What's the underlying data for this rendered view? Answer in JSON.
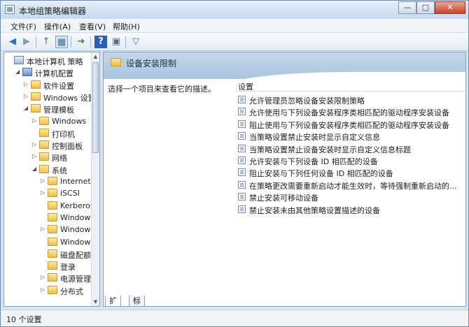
{
  "window": {
    "title": "本地组策略编辑器",
    "controls": {
      "minimize": "—",
      "maximize": "□",
      "close": "✕"
    }
  },
  "menu": [
    {
      "label": "文件(F)"
    },
    {
      "label": "操作(A)"
    },
    {
      "label": "查看(V)"
    },
    {
      "label": "帮助(H)"
    }
  ],
  "toolbar": {
    "back": "◀",
    "forward": "▶",
    "up": "↑",
    "showhide": "▦",
    "export": "➜",
    "help": "?",
    "properties": "▣",
    "filter": "▽",
    "icons": [
      "back-arrow-icon",
      "forward-arrow-icon",
      "up-folder-icon",
      "show-hide-tree-icon",
      "export-list-icon",
      "help-icon",
      "properties-icon",
      "filter-icon"
    ]
  },
  "tree": [
    {
      "label": "本地计算机 策略",
      "indent": 0,
      "toggle": "",
      "icon": "policy"
    },
    {
      "label": "计算机配置",
      "indent": 1,
      "toggle": "◢",
      "icon": "computer"
    },
    {
      "label": "软件设置",
      "indent": 2,
      "toggle": "▷",
      "icon": "folder"
    },
    {
      "label": "Windows 设置",
      "indent": 2,
      "toggle": "▷",
      "icon": "folder"
    },
    {
      "label": "管理模板",
      "indent": 2,
      "toggle": "◢",
      "icon": "folder"
    },
    {
      "label": "Windows",
      "indent": 3,
      "toggle": "▷",
      "icon": "folder"
    },
    {
      "label": "打印机",
      "indent": 3,
      "toggle": "",
      "icon": "folder"
    },
    {
      "label": "控制面板",
      "indent": 3,
      "toggle": "▷",
      "icon": "folder"
    },
    {
      "label": "网络",
      "indent": 3,
      "toggle": "▷",
      "icon": "folder"
    },
    {
      "label": "系统",
      "indent": 3,
      "toggle": "◢",
      "icon": "folder"
    },
    {
      "label": "Internet",
      "indent": 4,
      "toggle": "▷",
      "icon": "folder"
    },
    {
      "label": "iSCSI",
      "indent": 4,
      "toggle": "▷",
      "icon": "folder"
    },
    {
      "label": "Kerberos",
      "indent": 4,
      "toggle": "",
      "icon": "folder"
    },
    {
      "label": "Windows",
      "indent": 4,
      "toggle": "",
      "icon": "folder"
    },
    {
      "label": "Windows",
      "indent": 4,
      "toggle": "▷",
      "icon": "folder"
    },
    {
      "label": "Windows",
      "indent": 4,
      "toggle": "",
      "icon": "folder"
    },
    {
      "label": "磁盘配额",
      "indent": 4,
      "toggle": "",
      "icon": "folder"
    },
    {
      "label": "登录",
      "indent": 4,
      "toggle": "",
      "icon": "folder"
    },
    {
      "label": "电源管理",
      "indent": 4,
      "toggle": "▷",
      "icon": "folder"
    },
    {
      "label": "分布式",
      "indent": 4,
      "toggle": "▷",
      "icon": "folder"
    }
  ],
  "scrollbar": {
    "up": "▲",
    "down": "▼"
  },
  "detail": {
    "title": "设备安装限制",
    "description": "选择一个项目来查看它的描述。",
    "column_header": "设置",
    "items": [
      "允许管理员忽略设备安装限制策略",
      "允许使用与下列设备安装程序类相匹配的驱动程序安装设备",
      "阻止使用与下列设备安装程序类相匹配的驱动程序安装设备",
      "当策略设置禁止安装时显示自定义信息",
      "当策略设置禁止设备安装时显示自定义信息标题",
      "允许安装与下列设备 ID 相匹配的设备",
      "阻止安装与下列任何设备 ID 相匹配的设备",
      "在策略更改需要重新启动才能生效时，等待强制重新启动的...",
      "禁止安装可移动设备",
      "禁止安装未由其他策略设置描述的设备"
    ],
    "tabs": [
      "扩展",
      "标准"
    ]
  },
  "status": "10 个设置"
}
